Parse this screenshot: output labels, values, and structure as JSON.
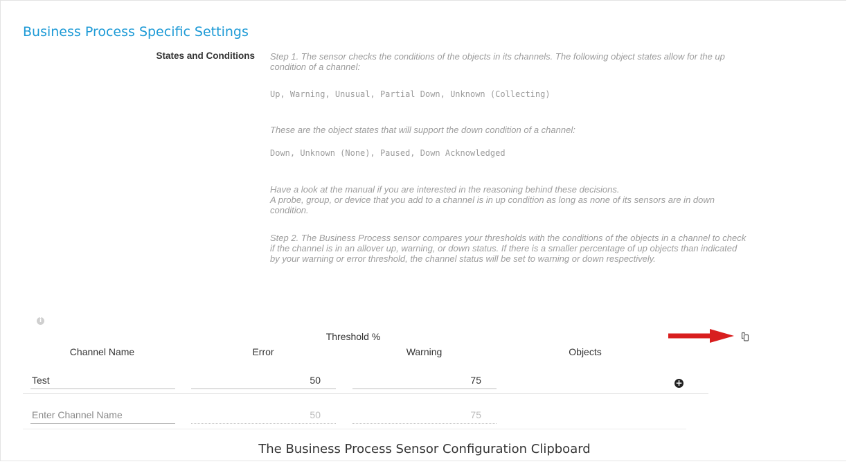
{
  "section": {
    "heading": "Business Process Specific Settings"
  },
  "states": {
    "label": "States and Conditions",
    "step1_intro": "Step 1. The sensor checks the conditions of the objects in its channels. The following object states allow for the up condition of a channel:",
    "up_states": "Up, Warning, Unusual, Partial Down, Unknown (Collecting)",
    "down_intro": "These are the object states that will support the down condition of a channel:",
    "down_states": "Down, Unknown (None), Paused, Down Acknowledged",
    "manual_note": "Have a look at the manual if you are interested in the reasoning behind these decisions.",
    "probe_note": "A probe, group, or device that you add to a channel is in up condition as long as none of its sensors are in down condition.",
    "step2": "Step 2. The Business Process sensor compares your thresholds with the conditions of the objects in a channel to check if the channel is in an allover up, warning, or down status. If there is a smaller percentage of up objects than indicated by your warning or error threshold, the channel status will be set to warning or down respectively."
  },
  "table": {
    "info_icon": "i",
    "threshold_header": "Threshold %",
    "columns": {
      "channel_name": "Channel Name",
      "error": "Error",
      "warning": "Warning",
      "objects": "Objects"
    },
    "row": {
      "channel": "Test",
      "error": "50",
      "warning": "75"
    },
    "new_row": {
      "channel_placeholder": "Enter Channel Name",
      "error_placeholder": "50",
      "warning_placeholder": "75"
    },
    "add_symbol": "+"
  },
  "icons": {
    "arrow": "red-arrow-icon",
    "clipboard": "clipboard-icon",
    "add": "plus-circle-icon",
    "info": "info-icon"
  },
  "colors": {
    "heading": "#1d9ad6",
    "arrow": "#d81e1e",
    "description": "#9c9c9c"
  },
  "caption": "The Business Process Sensor Configuration Clipboard"
}
